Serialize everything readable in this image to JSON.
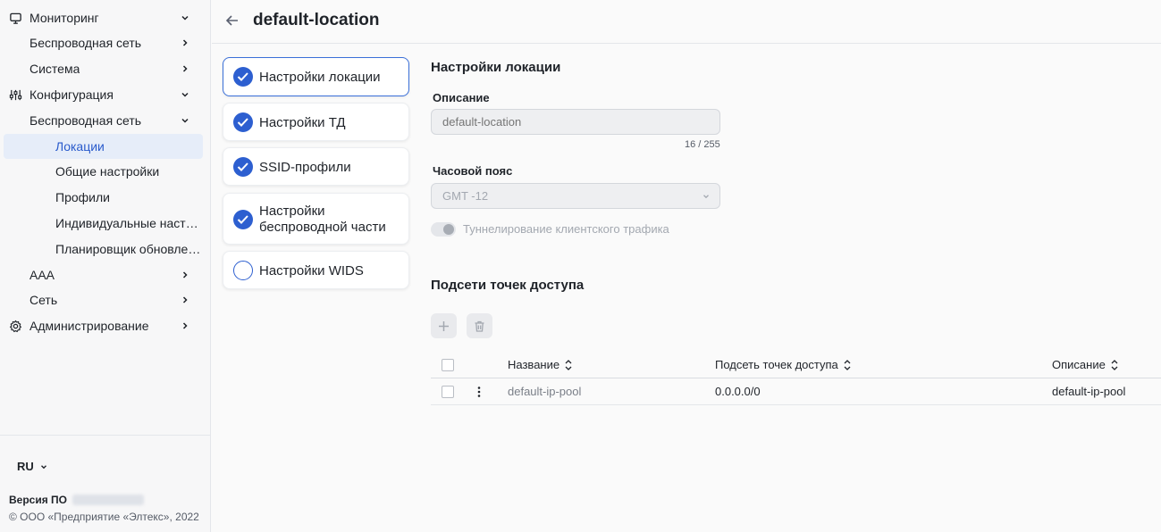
{
  "sidebar": {
    "items": [
      {
        "label": "Мониторинг"
      },
      {
        "label": "Беспроводная сеть"
      },
      {
        "label": "Система"
      },
      {
        "label": "Конфигурация"
      },
      {
        "label": "Беспроводная сеть"
      },
      {
        "label": "Локации"
      },
      {
        "label": "Общие настройки"
      },
      {
        "label": "Профили"
      },
      {
        "label": "Индивидуальные настро…"
      },
      {
        "label": "Планировщик обновлен…"
      },
      {
        "label": "AAA"
      },
      {
        "label": "Сеть"
      },
      {
        "label": "Администрирование"
      }
    ],
    "lang": "RU",
    "version_label": "Версия ПО",
    "copyright": "© ООО «Предприятие «Элтекс», 2022"
  },
  "header": {
    "title": "default-location"
  },
  "steps": [
    {
      "label": "Настройки локации",
      "done": true
    },
    {
      "label": "Настройки ТД",
      "done": true
    },
    {
      "label": "SSID-профили",
      "done": true
    },
    {
      "label": "Настройки беспроводной части",
      "done": true
    },
    {
      "label": "Настройки WIDS",
      "done": false
    }
  ],
  "form": {
    "section_title": "Настройки локации",
    "description_label": "Описание",
    "description_placeholder": "default-location",
    "description_counter": "16 / 255",
    "timezone_label": "Часовой пояс",
    "timezone_value": "GMT -12",
    "tunneling_label": "Туннелирование клиентского трафика"
  },
  "subnets": {
    "title": "Подсети точек доступа",
    "columns": [
      "Название",
      "Подсеть точек доступа",
      "Описание"
    ],
    "rows": [
      {
        "name": "default-ip-pool",
        "subnet": "0.0.0.0/0",
        "description": "default-ip-pool"
      }
    ]
  },
  "colors": {
    "accent": "#2d5fd0",
    "active_bg": "#e6edf9"
  }
}
